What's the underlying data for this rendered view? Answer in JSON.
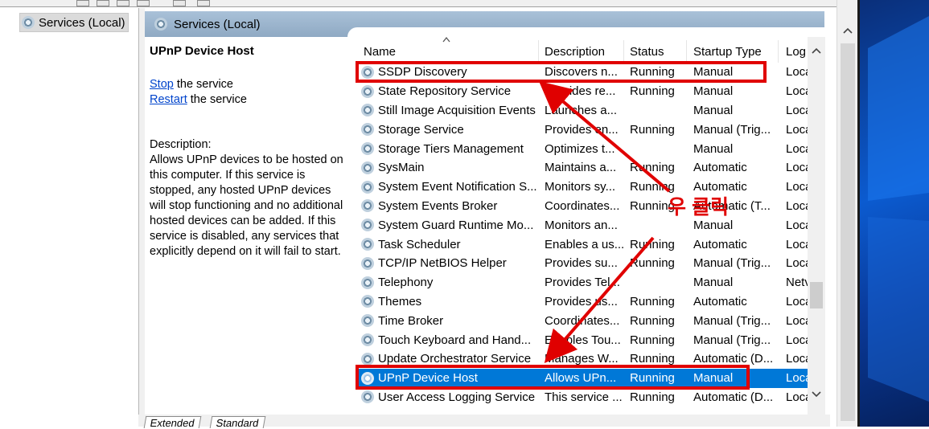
{
  "left_tree": {
    "label": "Services (Local)"
  },
  "header": {
    "title": "Services (Local)"
  },
  "details": {
    "service_name": "UPnP Device Host",
    "stop_link": "Stop",
    "stop_suffix": " the service",
    "restart_link": "Restart",
    "restart_suffix": " the service",
    "description_label": "Description:",
    "description": "Allows UPnP devices to be hosted on this computer. If this service is stopped, any hosted UPnP devices will stop functioning and no additional hosted devices can be added. If this service is disabled, any services that explicitly depend on it will fail to start."
  },
  "columns": {
    "name": "Name",
    "description": "Description",
    "status": "Status",
    "startup": "Startup Type",
    "logon": "Log"
  },
  "rows": [
    {
      "name": "SSDP Discovery",
      "description": "Discovers n...",
      "status": "Running",
      "startup": "Manual",
      "logon": "Loca"
    },
    {
      "name": "State Repository Service",
      "description": "Provides re...",
      "status": "Running",
      "startup": "Manual",
      "logon": "Loca"
    },
    {
      "name": "Still Image Acquisition Events",
      "description": "Launches a...",
      "status": "",
      "startup": "Manual",
      "logon": "Loca"
    },
    {
      "name": "Storage Service",
      "description": "Provides en...",
      "status": "Running",
      "startup": "Manual (Trig...",
      "logon": "Loca"
    },
    {
      "name": "Storage Tiers Management",
      "description": "Optimizes t...",
      "status": "",
      "startup": "Manual",
      "logon": "Loca"
    },
    {
      "name": "SysMain",
      "description": "Maintains a...",
      "status": "Running",
      "startup": "Automatic",
      "logon": "Loca"
    },
    {
      "name": "System Event Notification S...",
      "description": "Monitors sy...",
      "status": "Running",
      "startup": "Automatic",
      "logon": "Loca"
    },
    {
      "name": "System Events Broker",
      "description": "Coordinates...",
      "status": "Running",
      "startup": "Automatic (T...",
      "logon": "Loca"
    },
    {
      "name": "System Guard Runtime Mo...",
      "description": "Monitors an...",
      "status": "",
      "startup": "Manual",
      "logon": "Loca"
    },
    {
      "name": "Task Scheduler",
      "description": "Enables a us...",
      "status": "Running",
      "startup": "Automatic",
      "logon": "Loca"
    },
    {
      "name": "TCP/IP NetBIOS Helper",
      "description": "Provides su...",
      "status": "Running",
      "startup": "Manual (Trig...",
      "logon": "Loca"
    },
    {
      "name": "Telephony",
      "description": "Provides Tel...",
      "status": "",
      "startup": "Manual",
      "logon": "Netv"
    },
    {
      "name": "Themes",
      "description": "Provides us...",
      "status": "Running",
      "startup": "Automatic",
      "logon": "Loca"
    },
    {
      "name": "Time Broker",
      "description": "Coordinates...",
      "status": "Running",
      "startup": "Manual (Trig...",
      "logon": "Loca"
    },
    {
      "name": "Touch Keyboard and Hand...",
      "description": "Enables Tou...",
      "status": "Running",
      "startup": "Manual (Trig...",
      "logon": "Loca"
    },
    {
      "name": "Update Orchestrator Service",
      "description": "Manages W...",
      "status": "Running",
      "startup": "Automatic (D...",
      "logon": "Loca"
    },
    {
      "name": "UPnP Device Host",
      "description": "Allows UPn...",
      "status": "Running",
      "startup": "Manual",
      "logon": "Loca",
      "selected": true
    },
    {
      "name": "User Access Logging Service",
      "description": "This service ...",
      "status": "Running",
      "startup": "Automatic (D...",
      "logon": "Loca"
    }
  ],
  "tabs": {
    "extended": "Extended",
    "standard": "Standard"
  },
  "annotation": {
    "text": "우 클릭",
    "color": "#e00000"
  },
  "colors": {
    "selection": "#0078d7",
    "header": "#9bb5cd",
    "link": "#0044cc"
  }
}
